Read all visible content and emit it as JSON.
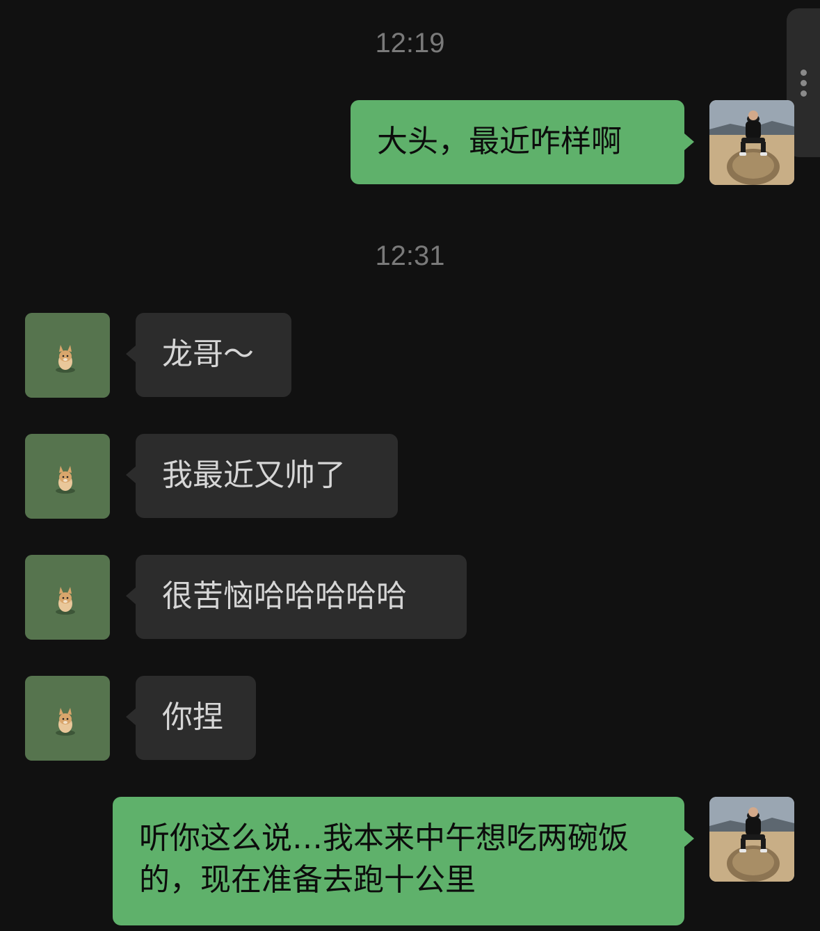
{
  "chat": {
    "timestamps": [
      "12:19",
      "12:31"
    ],
    "messages": [
      {
        "from": "me",
        "text": "大头，最近咋样啊"
      },
      {
        "from": "friend",
        "text": "龙哥～"
      },
      {
        "from": "friend",
        "text": "我最近又帅了"
      },
      {
        "from": "friend",
        "text": "很苦恼哈哈哈哈哈"
      },
      {
        "from": "friend",
        "text": "你捏"
      },
      {
        "from": "me",
        "text": "听你这么说…我本来中午想吃两碗饭的，现在准备去跑十公里"
      }
    ]
  },
  "colors": {
    "background": "#111111",
    "outgoing_bubble": "#5fb16b",
    "incoming_bubble": "#2c2c2c",
    "timestamp": "#7a7a7a"
  },
  "icons": {
    "my_avatar": "avatar-person-on-stone",
    "friend_avatar": "avatar-corgi-on-grass",
    "side_menu": "more-vertical-icon"
  }
}
